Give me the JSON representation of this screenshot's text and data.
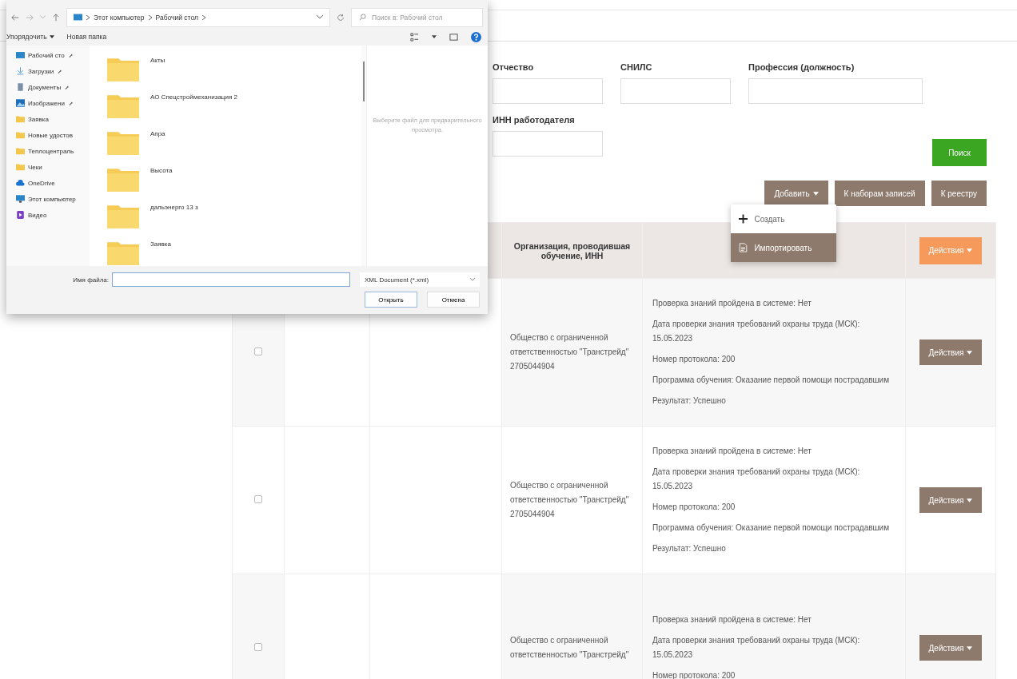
{
  "dialog": {
    "breadcrumb": [
      "Этот компьютер",
      "Рабочий стол"
    ],
    "search_placeholder": "Поиск в: Рабочий стол",
    "toolbar": [
      "Упорядочить",
      "Новая папка"
    ],
    "sidebar": [
      {
        "label": "Рабочий сто",
        "kind": "desktop",
        "pinned": true
      },
      {
        "label": "Загрузки",
        "kind": "download",
        "pinned": true
      },
      {
        "label": "Документы",
        "kind": "document",
        "pinned": true
      },
      {
        "label": "Изображени",
        "kind": "picture",
        "pinned": true
      },
      {
        "label": "Заявка",
        "kind": "folder",
        "pinned": false
      },
      {
        "label": "Новые удостов",
        "kind": "folder",
        "pinned": false
      },
      {
        "label": "Теплоцентраль",
        "kind": "folder",
        "pinned": false
      },
      {
        "label": "Чеки",
        "kind": "folder",
        "pinned": false
      },
      {
        "label": "OneDrive",
        "kind": "cloud",
        "pinned": false
      },
      {
        "label": "Этот компьютер",
        "kind": "computer",
        "pinned": false
      },
      {
        "label": "Видео",
        "kind": "video",
        "pinned": false
      }
    ],
    "folders": [
      "Акты",
      "АО Спецстроймеханизация 2",
      "Апра",
      "Высота",
      "дальэнерго 13 з",
      "Заявка"
    ],
    "preview_hint": "Выберите файл для предварительного просмотра.",
    "filename_label": "Имя файла:",
    "file_type": "XML Document (*.xml)",
    "buttons": [
      "Открыть",
      "Отмена"
    ]
  },
  "filters": [
    [
      {
        "label": "Отчество"
      },
      {
        "label": "СНИЛС"
      },
      {
        "label": "Профессия (должность)"
      }
    ],
    [
      {
        "label": "ИНН работодателя"
      }
    ]
  ],
  "search_button": "Поиск",
  "toolbar_buttons": [
    {
      "label": "Добавить",
      "dropdown": true
    },
    {
      "label": "К наборам записей",
      "dropdown": false
    },
    {
      "label": "К реестру",
      "dropdown": false
    }
  ],
  "add_menu": [
    {
      "label": "Создать",
      "kind": "create",
      "selected": false
    },
    {
      "label": "Импортировать",
      "kind": "import",
      "selected": true
    }
  ],
  "table": {
    "columns": [
      "Организация, проводившая обучение, ИНН"
    ],
    "actions_header": "Действия",
    "rows": [
      {
        "checked": false,
        "organization": "Общество с ограниченной ответственностью \"Транстрейд\" 2705044904",
        "details": [
          "Проверка знаний пройдена в системе: Нет",
          "Дата проверки знания требований охраны труда (МСК): 15.05.2023",
          "Номер протокола: 200",
          "Программа обучения: Оказание первой помощи пострадавшим",
          "Результат: Успешно"
        ],
        "action": "Действия"
      },
      {
        "checked": false,
        "organization": "Общество с ограниченной ответственностью \"Транстрейд\" 2705044904",
        "details": [
          "Проверка знаний пройдена в системе: Нет",
          "Дата проверки знания требований охраны труда (МСК): 15.05.2023",
          "Номер протокола: 200",
          "Программа обучения: Оказание первой помощи пострадавшим",
          "Результат: Успешно"
        ],
        "action": "Действия"
      },
      {
        "checked": false,
        "organization": "Общество с ограниченной ответственностью \"Транстрейд\"",
        "details": [
          "Проверка знаний пройдена в системе: Нет",
          "Дата проверки знания требований охраны труда (МСК): 15.05.2023",
          "Номер протокола: 200"
        ],
        "action": "Действия"
      }
    ]
  }
}
